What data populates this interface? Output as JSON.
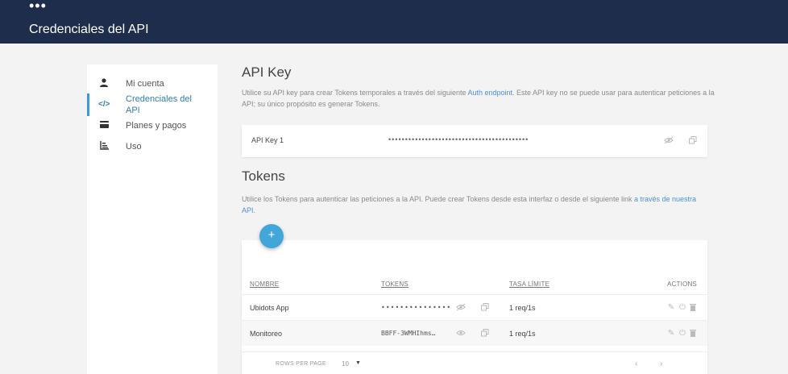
{
  "header": {
    "logo": "•••",
    "title": "Credenciales del API"
  },
  "sidebar": {
    "items": [
      {
        "label": "Mi cuenta",
        "icon": "user-icon"
      },
      {
        "label": "Credenciales del API",
        "icon": "code-icon",
        "active": true
      },
      {
        "label": "Planes y pagos",
        "icon": "credit-card-icon"
      },
      {
        "label": "Uso",
        "icon": "bar-chart-icon"
      }
    ]
  },
  "apikey": {
    "title": "API Key",
    "desc_before": "Utilice su API key para crear Tokens temporales a través del siguiente ",
    "desc_link": "Auth endpoint",
    "desc_after": ". Este API key no se puede usar para autenticar peticiones a la API; su único propósito es generar Tokens.",
    "name": "API Key 1",
    "masked": "••••••••••••••••••••••••••••••••••••••••••"
  },
  "tokens": {
    "title": "Tokens",
    "desc_before": "Utilice los Tokens para autenticar las peticiones a la API. Puede crear Tokens desde esta interfaz o desde el siguiente link ",
    "desc_link": "a través de nuestra API",
    "desc_after": ".",
    "add_label": "+",
    "columns": {
      "name": "NOMBRE",
      "tokens": "TOKENS",
      "rate": "TASA LÍMITE",
      "actions": "ACTIONS"
    },
    "rows": [
      {
        "name": "Ubidots App",
        "token": "•••••••••••••••",
        "rate": "1 req/1s"
      },
      {
        "name": "Monitoreo",
        "token": "BBFF-3WMHIhms…",
        "rate": "1 req/1s"
      }
    ],
    "footer": {
      "rows_per_page_label": "ROWS PER PAGE",
      "rows_per_page": "10",
      "prev": "‹",
      "next": "›"
    }
  },
  "colors": {
    "header_bg": "#1f2d4d",
    "accent": "#42a6d9",
    "link": "#4a90d9"
  }
}
